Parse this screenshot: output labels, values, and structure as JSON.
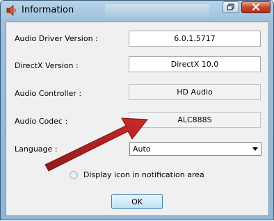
{
  "window": {
    "title": "Information",
    "colors": {
      "arrow": "#b01818",
      "close": "#c7452f",
      "ok_border": "#3c7fb1"
    }
  },
  "icons": [
    "speaker-icon",
    "restore-icon",
    "close-icon",
    "arrow-annotation"
  ],
  "fields": [
    {
      "label": "Audio Driver Version :",
      "value": "6.0.1.5717"
    },
    {
      "label": "DirectX Version :",
      "value": "DirectX 10.0"
    },
    {
      "label": "Audio Controller :",
      "value": "HD Audio"
    },
    {
      "label": "Audio Codec :",
      "value": "ALC888S"
    }
  ],
  "language": {
    "label": "Language :",
    "selected": "Auto"
  },
  "notification": {
    "label": "Display icon in notification area",
    "checked": false
  },
  "ok_label": "OK"
}
